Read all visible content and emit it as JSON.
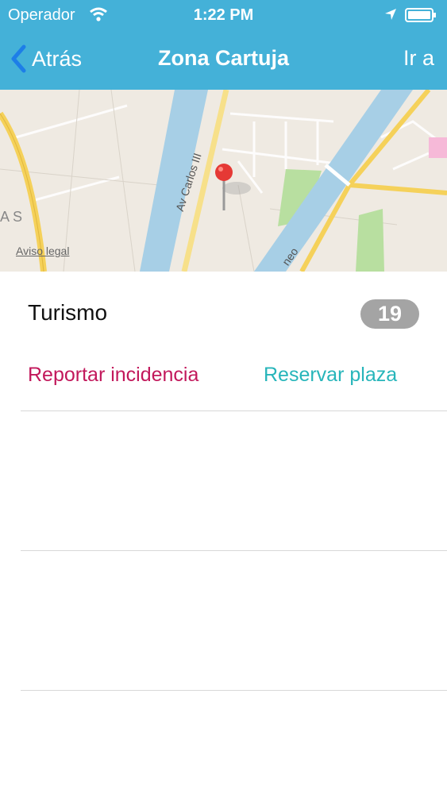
{
  "status_bar": {
    "carrier": "Operador",
    "time": "1:22 PM"
  },
  "nav": {
    "back_label": "Atrás",
    "title": "Zona Cartuja",
    "right_label": "Ir a"
  },
  "map": {
    "legal_label": "Aviso legal",
    "street_labels": [
      "Av Carlos III",
      "neo",
      "AS"
    ]
  },
  "detail": {
    "category": "Turismo",
    "count": "19"
  },
  "actions": {
    "report_label": "Reportar incidencia",
    "reserve_label": "Reservar plaza"
  },
  "colors": {
    "header_bg": "#44b1d8",
    "back_chevron": "#1d7ee8",
    "report": "#c2185b",
    "reserve": "#27b5ba",
    "badge_bg": "#a4a4a4"
  }
}
